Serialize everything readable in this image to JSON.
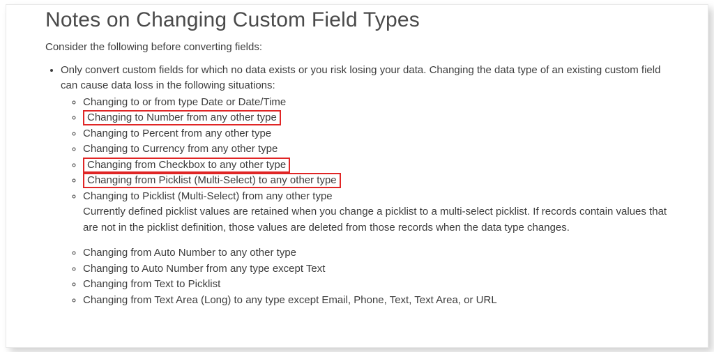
{
  "title": "Notes on Changing Custom Field Types",
  "intro": "Consider the following before converting fields:",
  "lead": "Only convert custom fields for which no data exists or you risk losing your data. Changing the data type of an existing custom field can cause data loss in the following situations:",
  "group1": {
    "i0": "Changing to or from type Date or Date/Time",
    "i1": "Changing to Number from any other type",
    "i2": "Changing to Percent from any other type",
    "i3": "Changing to Currency from any other type",
    "i4": "Changing from Checkbox to any other type",
    "i5": "Changing from Picklist (Multi-Select) to any other type",
    "i6": "Changing to Picklist (Multi-Select) from any other type",
    "i6_note": "Currently defined picklist values are retained when you change a picklist to a multi-select picklist. If records contain values that are not in the picklist definition, those values are deleted from those records when the data type changes."
  },
  "group2": {
    "i0": "Changing from Auto Number to any other type",
    "i1": "Changing to Auto Number from any type except Text",
    "i2": "Changing from Text to Picklist",
    "i3": "Changing from Text Area (Long) to any type except Email, Phone, Text, Text Area, or URL"
  },
  "highlight_indices_group1": [
    1,
    4,
    5
  ]
}
